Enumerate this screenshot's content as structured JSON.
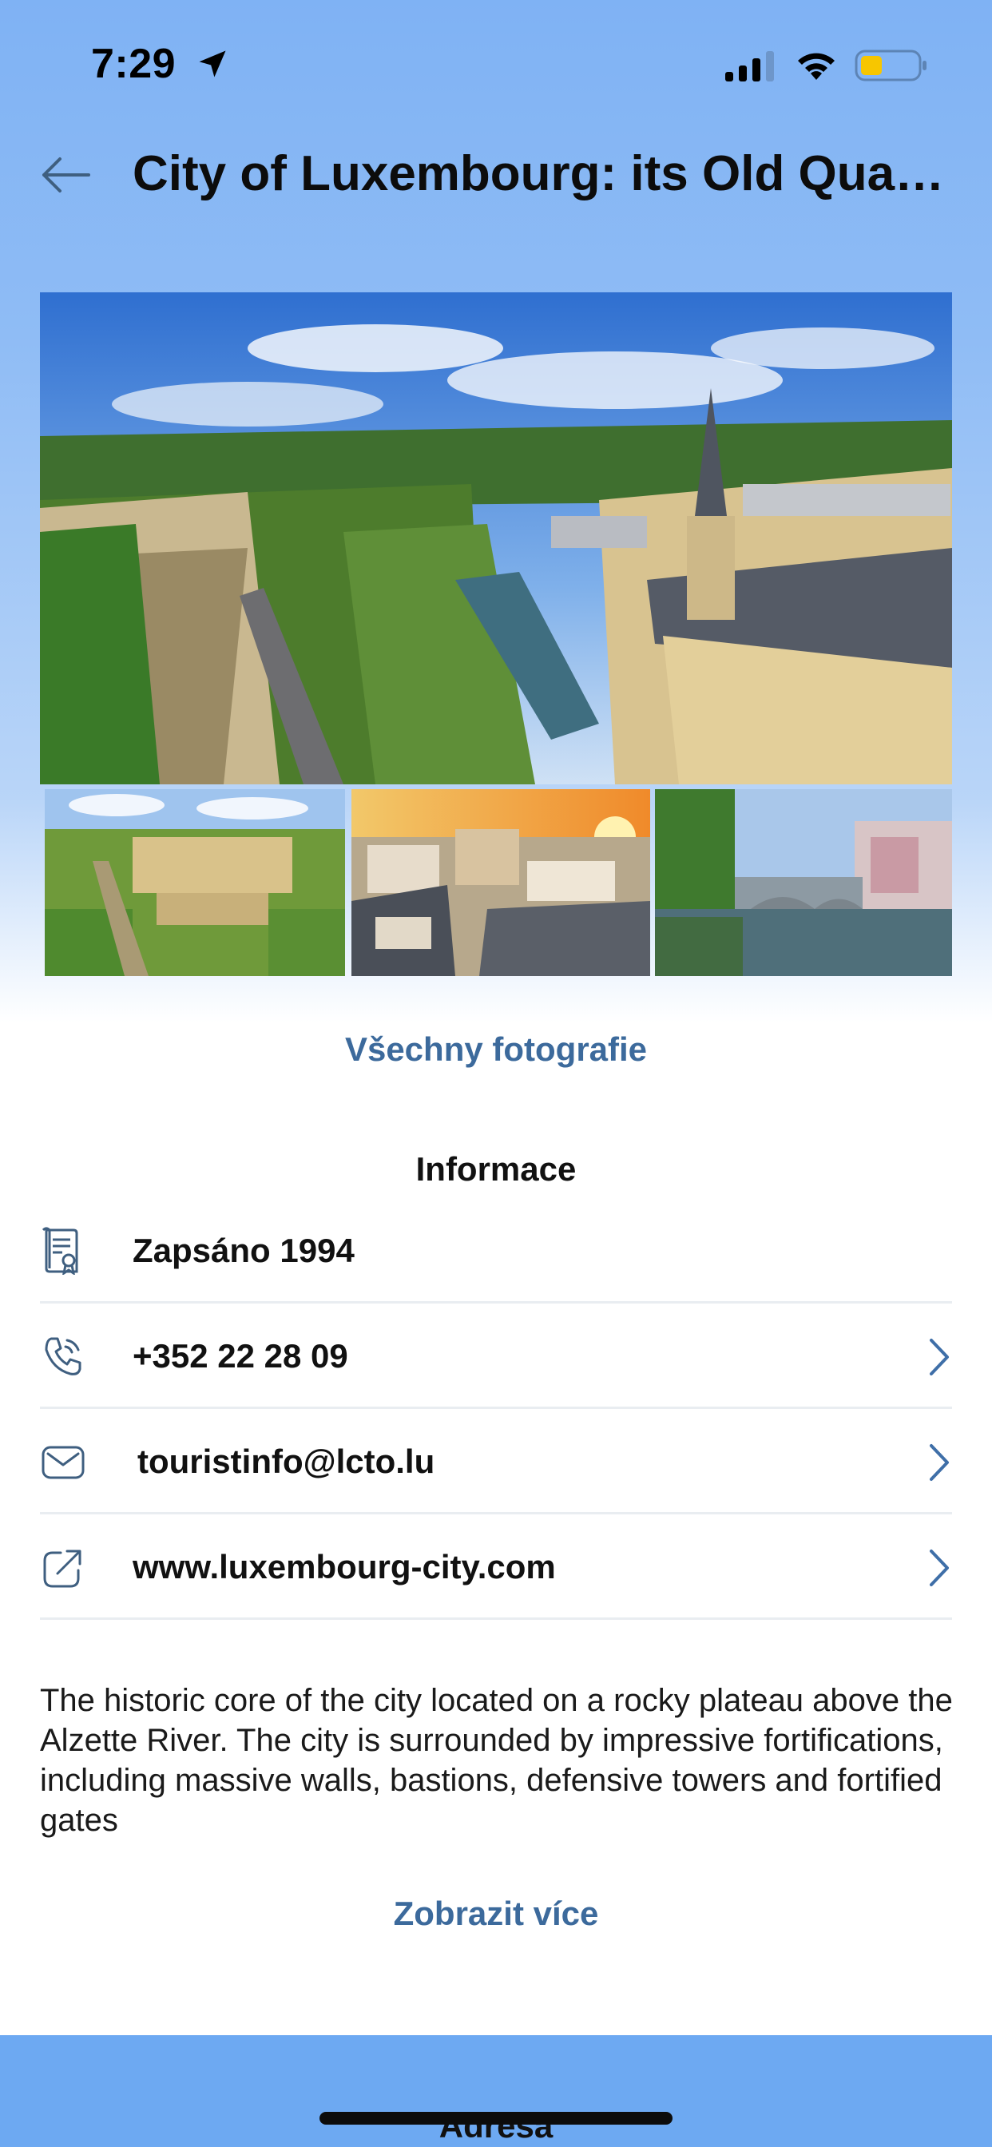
{
  "status_bar": {
    "time": "7:29",
    "icons": [
      "location-arrow-icon",
      "cellular-signal-icon",
      "wifi-icon",
      "battery-low-icon"
    ],
    "battery_color": "#f7c600"
  },
  "header": {
    "title": "City of Luxembourg: its Old Qua…",
    "back_icon": "arrow-left-icon"
  },
  "gallery": {
    "photos": [
      "main-photo",
      "thumbnail-1",
      "thumbnail-2",
      "thumbnail-3"
    ],
    "all_photos_label": "Všechny fotografie"
  },
  "info": {
    "title": "Informace",
    "rows": [
      {
        "icon": "certificate-icon",
        "text": "Zapsáno 1994",
        "has_chevron": false
      },
      {
        "icon": "phone-icon",
        "text": "+352 22 28 09",
        "has_chevron": true
      },
      {
        "icon": "mail-icon",
        "text": "touristinfo@lcto.lu",
        "has_chevron": true
      },
      {
        "icon": "external-link-icon",
        "text": "www.luxembourg-city.com",
        "has_chevron": true
      }
    ]
  },
  "description": "The historic core of the city located on a rocky plateau above the Alzette River. The city is surrounded by impressive fortifications, including massive walls, bastions, defensive towers and fortified gates",
  "show_more_label": "Zobrazit více",
  "bottom_bar": {
    "label": "Adresa"
  },
  "colors": {
    "accent": "#3c6a9c",
    "header_bg": "#7fb2f4",
    "bottom_bar_bg": "#6da9f2",
    "divider": "#e9edf1"
  }
}
